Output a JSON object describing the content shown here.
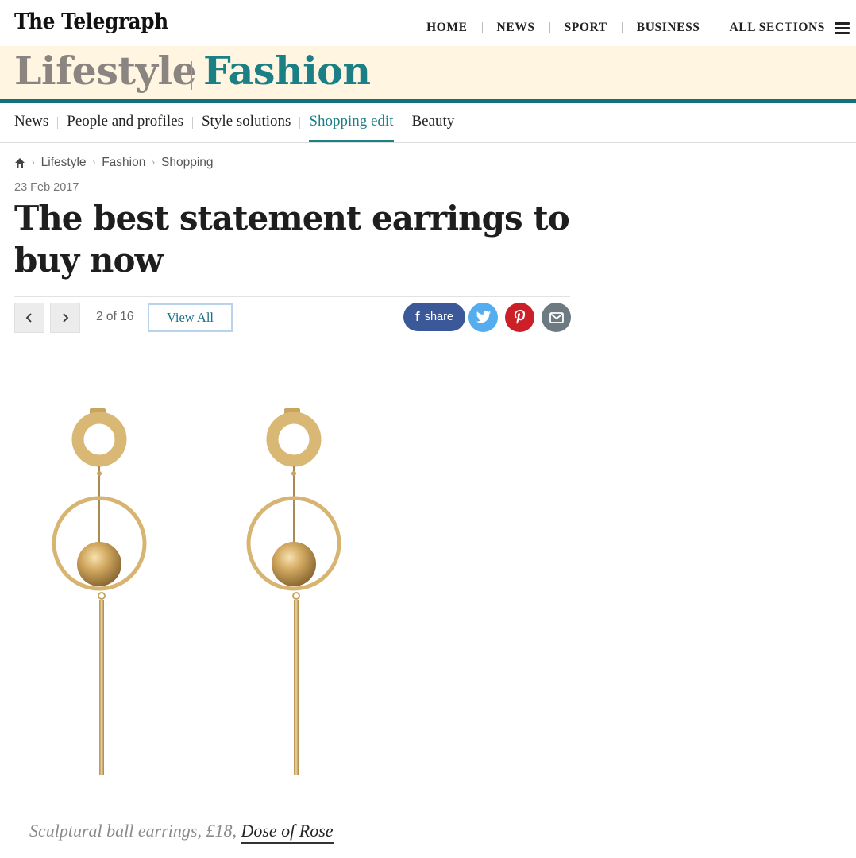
{
  "masthead": {
    "logo": "The Telegraph",
    "nav": [
      "HOME",
      "NEWS",
      "SPORT",
      "BUSINESS",
      "ALL SECTIONS"
    ]
  },
  "banner": {
    "section": "Lifestyle",
    "subsection": "Fashion"
  },
  "subnav": {
    "items": [
      "News",
      "People and profiles",
      "Style solutions",
      "Shopping edit",
      "Beauty"
    ],
    "active": "Shopping edit"
  },
  "breadcrumb": [
    "Lifestyle",
    "Fashion",
    "Shopping"
  ],
  "article": {
    "date": "23 Feb 2017",
    "headline": "The best statement earrings to buy now"
  },
  "gallery": {
    "counter": "2 of 16",
    "view_all": "View All",
    "share_label": "share"
  },
  "caption": {
    "text": "Sculptural ball earrings, £18, ",
    "link": "Dose of Rose"
  },
  "colors": {
    "brand_teal": "#1b7f86",
    "banner_bg": "#fff5e1",
    "facebook": "#3b5998",
    "twitter": "#55acee",
    "pinterest": "#cb2027",
    "email": "#6d7a82",
    "gold": "#d4b36a"
  },
  "icons": [
    "hamburger-menu-icon",
    "home-icon",
    "chevron-left-icon",
    "chevron-right-icon",
    "facebook-icon",
    "twitter-icon",
    "pinterest-icon",
    "email-icon"
  ]
}
